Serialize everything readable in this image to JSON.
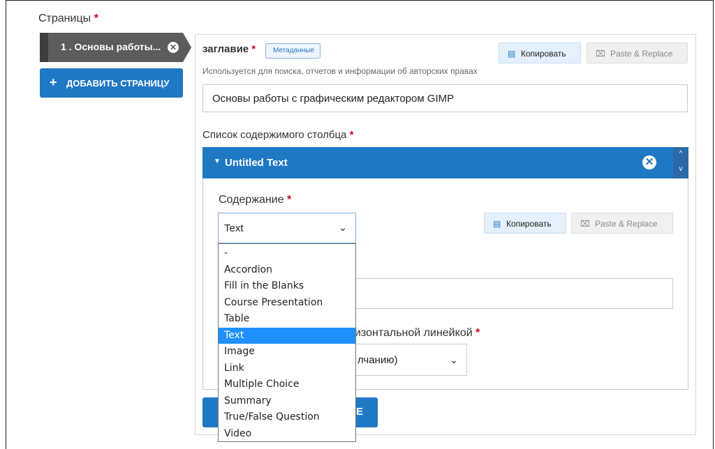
{
  "pages": {
    "title": "Страницы",
    "tab_label": "1 . Основы работы...",
    "add_button": "ДОБАВИТЬ СТРАНИЦУ"
  },
  "title_field": {
    "label": "заглавие",
    "badge": "Метаданные",
    "description": "Используется для поиска, отчетов и информации об авторских правах",
    "value": "Основы работы с графическим редактором GIMP",
    "copy_label": "Копировать",
    "paste_label": "Paste & Replace"
  },
  "column_list": {
    "label": "Список содержимого столбца",
    "item_title": "Untitled Text"
  },
  "content_field": {
    "label": "Содержание",
    "selected": "Text",
    "copy_label": "Копировать",
    "paste_label": "Paste & Replace",
    "options": [
      "-",
      "Accordion",
      "Fill in the Blanks",
      "Course Presentation",
      "Table",
      "Text",
      "Image",
      "Link",
      "Multiple Choice",
      "Summary",
      "True/False Question",
      "Video"
    ],
    "selected_index": 5
  },
  "hr_field": {
    "label_partial": "изонтальной линейкой",
    "value_partial": "лчанию)"
  },
  "bottom_button": {
    "label_partial": "E"
  },
  "colors": {
    "accent": "#1f78c4",
    "required": "#d0021b",
    "selection": "#1e90ff",
    "tab": "#5c5c5c"
  },
  "icons": {
    "close": "close-circle-icon",
    "copy": "copy-icon",
    "paste": "paste-icon",
    "plus": "plus-icon",
    "caret": "caret-down-icon",
    "chevron": "chevron-down-icon"
  }
}
